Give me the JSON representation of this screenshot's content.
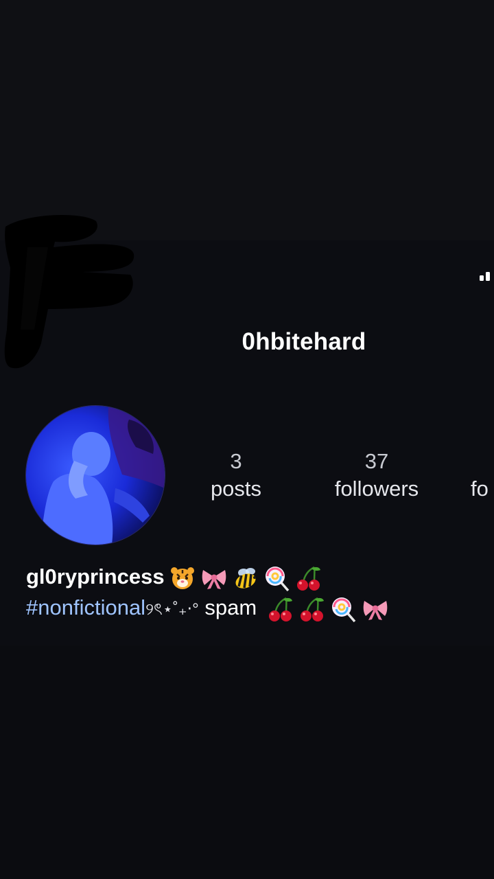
{
  "profile": {
    "username": "0hbitehard",
    "display_name": "gl0ryprincess",
    "bio_hashtag": "#nonfictional",
    "bio_decoration": "୨ৎ⋆˚₊‧°",
    "bio_text": "spam",
    "name_emojis": [
      "tiger-face",
      "pink-bow",
      "bee",
      "lollipop",
      "cherries"
    ],
    "bio_emojis": [
      "cherries",
      "cherries",
      "lollipop",
      "pink-bow"
    ]
  },
  "stats": {
    "posts": {
      "value": "3",
      "label": "posts"
    },
    "followers": {
      "value": "37",
      "label": "followers"
    },
    "following": {
      "value": "",
      "label": "fo"
    }
  },
  "colors": {
    "background": "#0b0c10",
    "hashtag": "#9fc4ff",
    "avatar_glow": "#1a2bff"
  }
}
